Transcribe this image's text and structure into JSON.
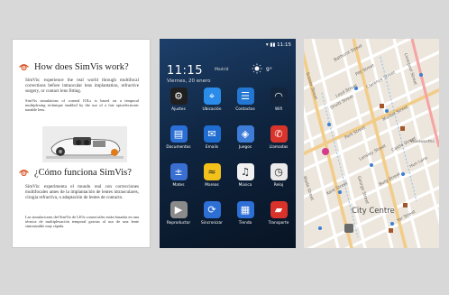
{
  "doc": {
    "heading_en": "How does SimVis work?",
    "para1_en": "SimVis: experience the real world through multifocal corrections before intraocular lens implantation, refractive surgery, or contact lens fitting.",
    "para2_en": "SimVis simulations of corneal IOLs is based on a temporal multiplexing technique enabled by the use of a fast optoelectronic tunable lens.",
    "heading_es": "¿Cómo funciona SimVis?",
    "para1_es": "SimVis: experimenta el mundo real con correcciones multifocales antes de la implantación de lentes intraoculares, cirugía refractiva, o adaptación de lentes de contacto.",
    "para2_es": "Las simulaciones del SimVis de LIOs comerciales están basadas en una técnica de multiplexación temporal gracias al uso de una lente sintonizable muy rápida.",
    "accent_color": "#d9572b"
  },
  "phone": {
    "status_time": "11:15",
    "clock": "11:15",
    "city": "Madrid",
    "date": "Viernes, 20 enero",
    "temperature": "9°",
    "apps": [
      {
        "label": "Ajustes",
        "icon": "settings-icon",
        "color": "#1f1f1f"
      },
      {
        "label": "Ubicación",
        "icon": "location-pin-icon",
        "color": "#2a8be8"
      },
      {
        "label": "Contactos",
        "icon": "contacts-icon",
        "color": "#2377d2"
      },
      {
        "label": "Wifi",
        "icon": "wifi-icon",
        "color": "#13243d"
      },
      {
        "label": "Documentos",
        "icon": "documents-icon",
        "color": "#2b6fd6"
      },
      {
        "label": "Emails",
        "icon": "email-icon",
        "color": "#1f6dd1"
      },
      {
        "label": "Juegos",
        "icon": "gamepad-icon",
        "color": "#3d7dd8"
      },
      {
        "label": "Llamadas",
        "icon": "phone-icon",
        "color": "#d8342b"
      },
      {
        "label": "Mates",
        "icon": "calculator-icon",
        "color": "#3a6fd2"
      },
      {
        "label": "Mareas",
        "icon": "tides-icon",
        "color": "#f2c21a"
      },
      {
        "label": "Música",
        "icon": "music-icon",
        "color": "#f1f1f1"
      },
      {
        "label": "Reloj",
        "icon": "clock-icon",
        "color": "#eaeaea"
      },
      {
        "label": "Reproductor",
        "icon": "play-icon",
        "color": "#8a8a8a"
      },
      {
        "label": "Sincronizar",
        "icon": "sync-icon",
        "color": "#2e6fd6"
      },
      {
        "label": "Tienda",
        "icon": "store-icon",
        "color": "#2d6fd6"
      },
      {
        "label": "Transporte",
        "icon": "car-icon",
        "color": "#d8322a"
      }
    ]
  },
  "map": {
    "city_label": "City Centre",
    "street_labels": [
      "Bathurst Street",
      "Pitt Street",
      "Sussex Street",
      "Clarence Street",
      "Liverpool Street",
      "Druitt Street",
      "Market Street",
      "Park Street",
      "Castle Street",
      "Lansley Street",
      "Wade Street",
      "Kent Street",
      "Burg Street",
      "George Street",
      "Hun Lane",
      "Woolworths",
      "Yor Street",
      "Loyd Street"
    ]
  }
}
